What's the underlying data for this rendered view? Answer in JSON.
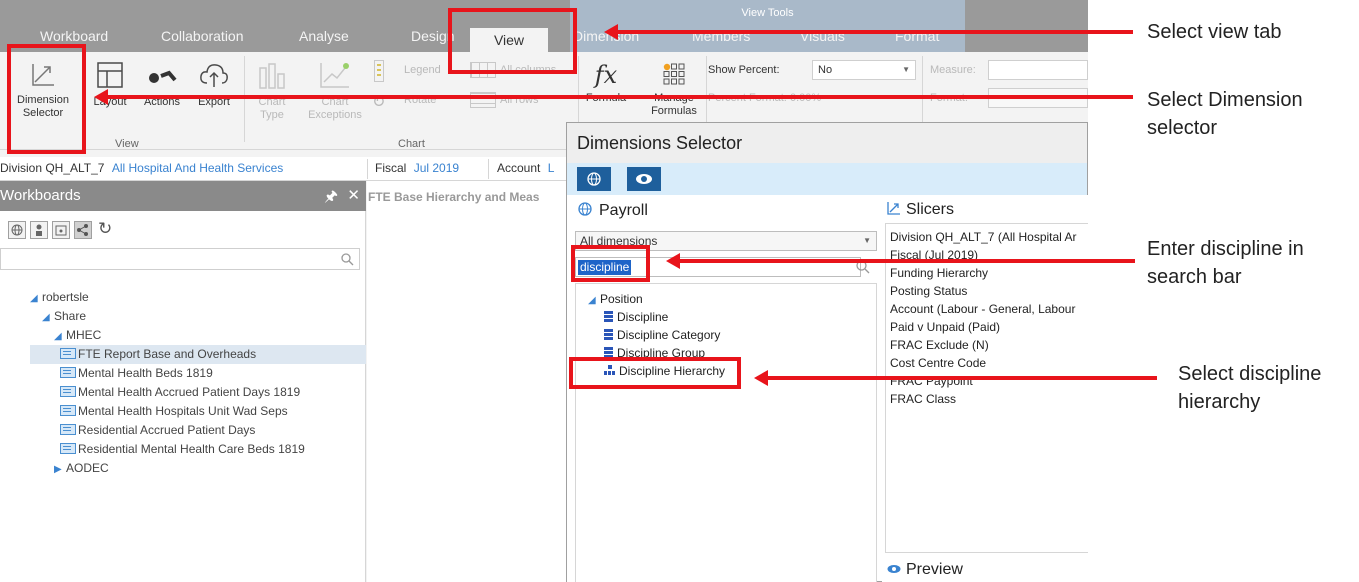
{
  "tabs": {
    "workboard": "Workboard",
    "collaboration": "Collaboration",
    "analyse": "Analyse",
    "design": "Design",
    "view": "View",
    "dimension": "Dimension",
    "members": "Members",
    "visuals": "Visuals",
    "format": "Format",
    "view_tools": "View Tools"
  },
  "ribbon": {
    "dimension_selector": "Dimension Selector",
    "layout": "Layout",
    "actions": "Actions",
    "export": "Export",
    "chart_type": "Chart Type",
    "chart_exceptions": "Chart Exceptions",
    "legend": "Legend",
    "rotate": "Rotate",
    "all_columns": "All columns",
    "all_rows": "All rows",
    "formula": "Formula",
    "manage_formulas": "Manage Formulas",
    "group_view": "View",
    "group_chart": "Chart",
    "show_percent_label": "Show Percent:",
    "show_percent_value": "No",
    "percent_format_label": "Percent Format:",
    "percent_format_value": "0.00%",
    "measure_label": "Measure:",
    "format_label": "Format:"
  },
  "filterbar": {
    "division_label": "Division QH_ALT_7",
    "division_value": "All Hospital And Health Services",
    "fiscal_label": "Fiscal",
    "fiscal_value": "Jul 2019",
    "account_label": "Account",
    "account_value": "L"
  },
  "workboards": {
    "title": "Workboards",
    "search_placeholder": "",
    "tree": {
      "root": "robertsle",
      "share": "Share",
      "mhec": "MHEC",
      "reports": [
        "FTE Report Base and Overheads",
        "Mental Health Beds 1819",
        "Mental Health  Accrued Patient Days 1819",
        "Mental Health Hospitals Unit Wad Seps",
        "Residential Accrued Patient Days",
        "Residential Mental Health Care Beds 1819"
      ],
      "aodec": "AODEC"
    }
  },
  "main": {
    "title": "FTE Base Hierarchy and Meas"
  },
  "dialog": {
    "title": "Dimensions Selector",
    "payroll": "Payroll",
    "all_dimensions": "All dimensions",
    "search_value": "discipline",
    "tree": {
      "position": "Position",
      "items": [
        "Discipline",
        "Discipline Category",
        "Discipline Group",
        "Discipline Hierarchy"
      ]
    },
    "slicers_title": "Slicers",
    "slicers": [
      "Division QH_ALT_7 (All Hospital Ar",
      "Fiscal (Jul 2019)",
      "Funding Hierarchy",
      "Posting Status",
      "Account (Labour - General, Labour",
      "Paid v Unpaid (Paid)",
      "FRAC Exclude (N)",
      "Cost Centre Code",
      "FRAC Paypoint",
      "FRAC Class"
    ],
    "preview_title": "Preview"
  },
  "annotations": {
    "select_view_tab": "Select view tab",
    "select_dimension_selector": "Select Dimension selector",
    "enter_discipline": "Enter discipline in search bar",
    "select_discipline_hierarchy": "Select discipline hierarchy"
  },
  "colors": {
    "annotation_red": "#e8141b",
    "tabbar_gray": "#9a9a9a",
    "view_tools_blue": "#a9b9c9",
    "link_blue": "#3a83d0",
    "dialog_button_blue": "#1e5f9c"
  }
}
